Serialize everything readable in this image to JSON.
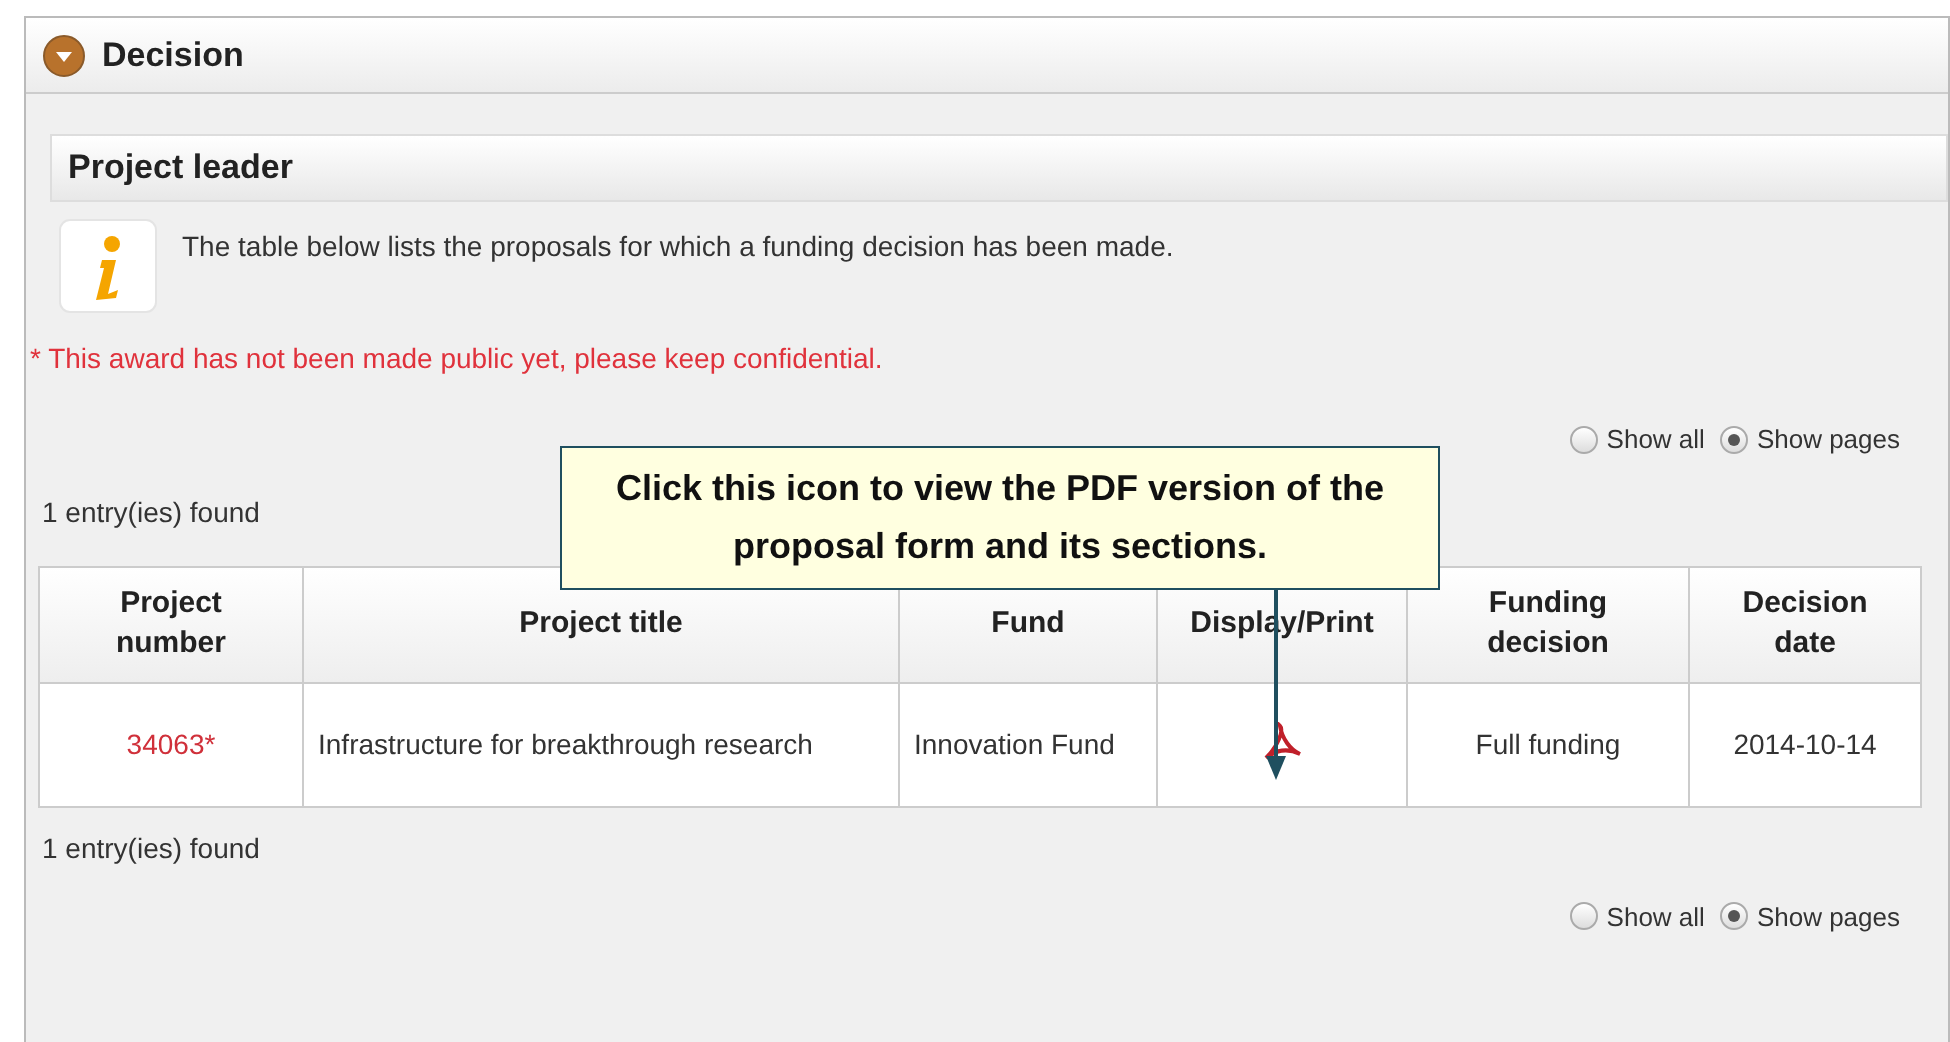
{
  "panel": {
    "title": "Decision"
  },
  "section": {
    "title": "Project leader"
  },
  "info": "The table below lists the proposals for which a funding decision has been made.",
  "warning": "* This award has not been made public yet, please keep confidential.",
  "view_options_top": [
    {
      "label": "Show all",
      "selected": false
    },
    {
      "label": "Show pages",
      "selected": true
    }
  ],
  "count_top": "1 entry(ies) found",
  "table": {
    "columns": [
      "Project number",
      "Project title",
      "Fund",
      "Display/Print",
      "Funding decision",
      "Decision date"
    ],
    "rows": [
      {
        "project_number": "34063*",
        "project_title": "Infrastructure for breakthrough research",
        "fund": "Innovation Fund",
        "funding_decision": "Full funding",
        "decision_date": "2014-10-14"
      }
    ]
  },
  "count_bottom": "1 entry(ies) found",
  "view_options_bottom": [
    {
      "label": "Show all",
      "selected": false
    },
    {
      "label": "Show pages",
      "selected": true
    }
  ],
  "callout": "Click this icon to view the PDF version of the proposal form and its sections."
}
